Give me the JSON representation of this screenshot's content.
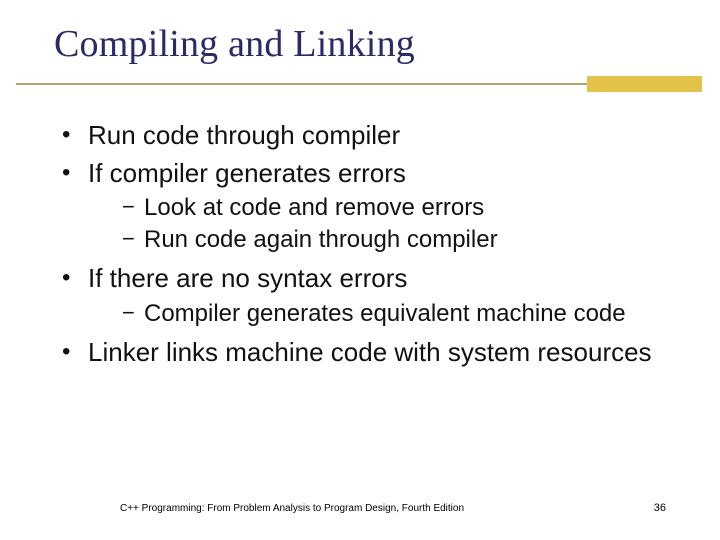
{
  "title": "Compiling and Linking",
  "bullets": {
    "b1": "Run code through compiler",
    "b2": "If compiler generates errors",
    "b2_sub1": "Look at code and remove errors",
    "b2_sub2": "Run code again through compiler",
    "b3": "If there are no syntax errors",
    "b3_sub1": "Compiler generates equivalent machine code",
    "b4": "Linker links machine code with system resources"
  },
  "footer": {
    "left": "C++ Programming: From Problem Analysis to Program Design, Fourth Edition",
    "right": "36"
  }
}
